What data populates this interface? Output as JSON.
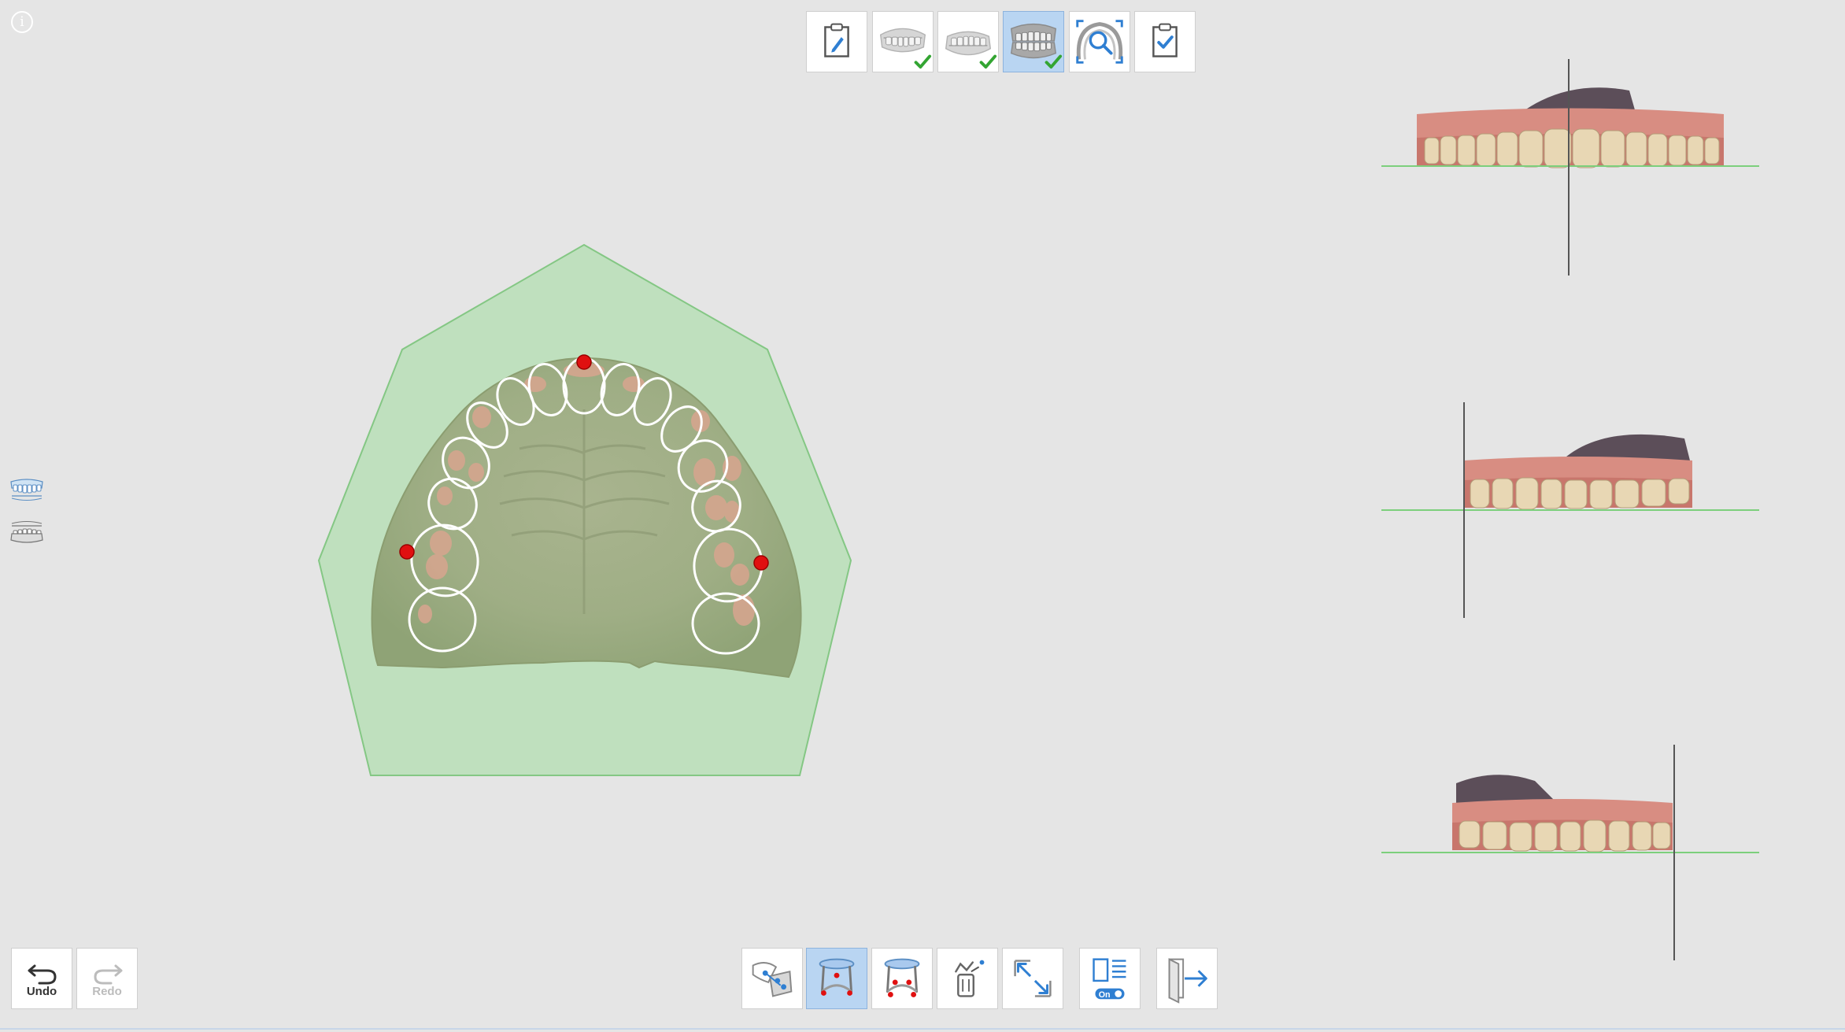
{
  "info": {
    "glyph": "i"
  },
  "history": {
    "undo_label": "Undo",
    "redo_label": "Redo",
    "redo_enabled": false
  },
  "top_toolbar": [
    {
      "icon": "clipboard-edit-icon",
      "completed": false,
      "active": false
    },
    {
      "icon": "upper-jaw-icon",
      "completed": true,
      "active": false
    },
    {
      "icon": "lower-jaw-icon",
      "completed": true,
      "active": false
    },
    {
      "icon": "occlusion-icon",
      "completed": true,
      "active": true
    },
    {
      "icon": "arch-scan-search-icon",
      "completed": false,
      "active": false
    },
    {
      "icon": "clipboard-check-icon",
      "completed": false,
      "active": false
    }
  ],
  "bottom_toolbar": [
    {
      "icon": "align-points-icon",
      "active": false
    },
    {
      "icon": "arch-points-upper-icon",
      "active": true
    },
    {
      "icon": "arch-points-lower-icon",
      "active": false
    },
    {
      "icon": "remove-points-icon",
      "active": false
    },
    {
      "icon": "expand-view-icon",
      "active": false
    },
    {
      "icon": "layout-toggle-icon",
      "active": false,
      "toggle_label": "On"
    },
    {
      "icon": "exit-icon",
      "active": false
    }
  ],
  "side_panel": [
    {
      "icon": "upper-jaw-visibility-icon"
    },
    {
      "icon": "lower-jaw-visibility-icon"
    }
  ],
  "colors": {
    "background": "#e5e5e5",
    "active_tool": "#b9d5f2",
    "check_green": "#33a532",
    "accent_blue": "#2f7fd2",
    "point_red": "#e01010",
    "plane_fill": "#bfe0be",
    "plane_edge": "#84c784",
    "tooth_outline": "#ffffff",
    "gum_pink": "#d9716d",
    "tooth_ivory": "#e8d7b4"
  }
}
